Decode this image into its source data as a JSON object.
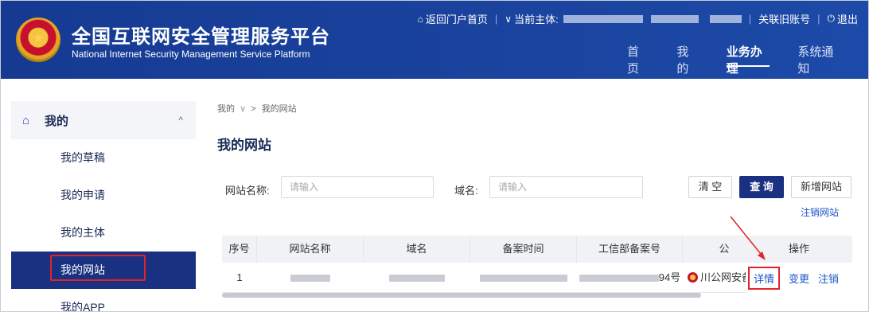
{
  "header": {
    "title": "全国互联网安全管理服务平台",
    "subtitle": "National Internet Security Management Service Platform",
    "emblem_icon": "police-emblem-icon",
    "back_portal": "返回门户首页",
    "current_subject_label": "当前主体:",
    "relink_label": "关联旧账号",
    "logout_label": "退出",
    "nav": [
      "首页",
      "我的",
      "业务办理",
      "系统通知"
    ],
    "nav_active": "业务办理"
  },
  "sidebar": {
    "group_label": "我的",
    "items": [
      "我的草稿",
      "我的申请",
      "我的主体",
      "我的网站",
      "我的APP"
    ],
    "active": "我的网站"
  },
  "breadcrumb": {
    "parent": "我的",
    "current": "我的网站"
  },
  "page_title": "我的网站",
  "search": {
    "site_name_label": "网站名称:",
    "site_name_placeholder": "请输入",
    "domain_label": "域名:",
    "domain_placeholder": "请输入",
    "clear_button": "清 空",
    "query_button": "查 询",
    "add_button": "新增网站",
    "cancel_link": "注销网站"
  },
  "table": {
    "columns": [
      "序号",
      "网站名称",
      "域名",
      "备案时间",
      "工信部备案号",
      "公"
    ],
    "rows": [
      {
        "index": "1",
        "icp_suffix": "94号",
        "unit": "川公网安备"
      }
    ],
    "ops_header": "操作",
    "ops": [
      "详情",
      "变更",
      "注销"
    ]
  },
  "colors": {
    "header_bg": "#1d4aa8",
    "active_nav": "#1a3080",
    "highlight": "#e0242b",
    "link": "#1a56c8"
  }
}
